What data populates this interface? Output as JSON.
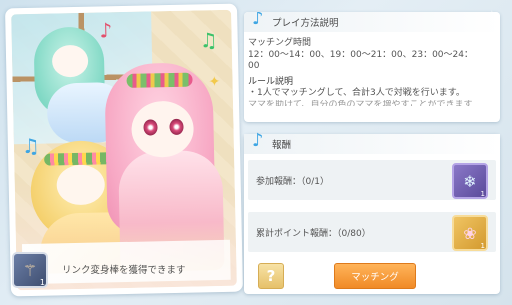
{
  "illustration": {
    "caption": "リンク変身棒を獲得できます",
    "item_icon": "wand-icon",
    "item_count": "1"
  },
  "rules_panel": {
    "title": "プレイ方法説明",
    "match_time_heading": "マッチング時間",
    "match_time_line1": "12：00～14：00、19：00～21：00、23：00～24：",
    "match_time_line2": "00",
    "rule_heading": "ルール説明",
    "rule_line1": "・1人でマッチングして、合計3人で対戦を行います。",
    "rule_line2_partial": "ママを助けて、自分の色のママを増やすことができます"
  },
  "rewards_panel": {
    "title": "報酬",
    "participation_label": "参加報酬：（0/1）",
    "participation_icon": "gift-box-icon",
    "participation_count": "1",
    "points_label": "累計ポイント報酬：（0/80）",
    "points_icon": "treasure-chest-icon",
    "points_count": "1"
  },
  "actions": {
    "help_label": "?",
    "match_label": "マッチング"
  },
  "colors": {
    "accent_orange": "#f08a26",
    "note_blue": "#3fa6e3",
    "panel_bg": "#ffffff"
  }
}
